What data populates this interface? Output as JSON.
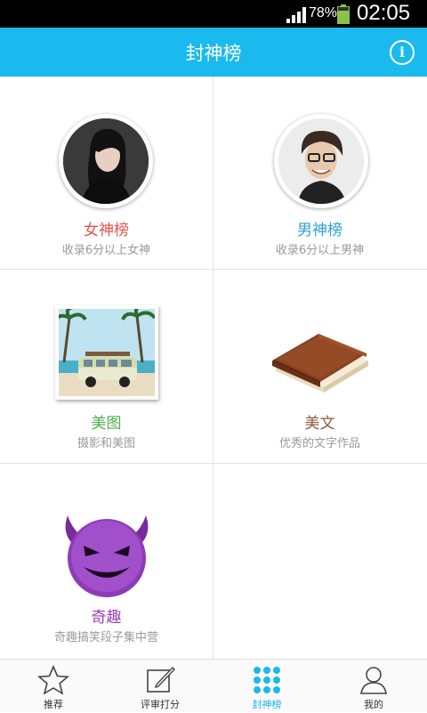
{
  "status_bar": {
    "battery_percent": "78%",
    "time": "02:05"
  },
  "header": {
    "title": "封神榜"
  },
  "categories": [
    {
      "name": "女神榜",
      "desc": "收录6分以上女神",
      "color": "#e8504e"
    },
    {
      "name": "男神榜",
      "desc": "收录6分以上男神",
      "color": "#2d9fd8"
    },
    {
      "name": "美图",
      "desc": "摄影和美图",
      "color": "#4cae4c"
    },
    {
      "name": "美文",
      "desc": "优秀的文字作品",
      "color": "#8a5a3b"
    },
    {
      "name": "奇趣",
      "desc": "奇趣搞笑段子集中营",
      "color": "#9b3bb5"
    }
  ],
  "tabs": [
    {
      "label": "推荐",
      "icon": "star-icon",
      "active": false
    },
    {
      "label": "评审打分",
      "icon": "edit-icon",
      "active": false
    },
    {
      "label": "封神榜",
      "icon": "grid-dots-icon",
      "active": true
    },
    {
      "label": "我的",
      "icon": "person-icon",
      "active": false
    }
  ],
  "colors": {
    "accent": "#1ab9ee",
    "statusbar": "#000000"
  }
}
